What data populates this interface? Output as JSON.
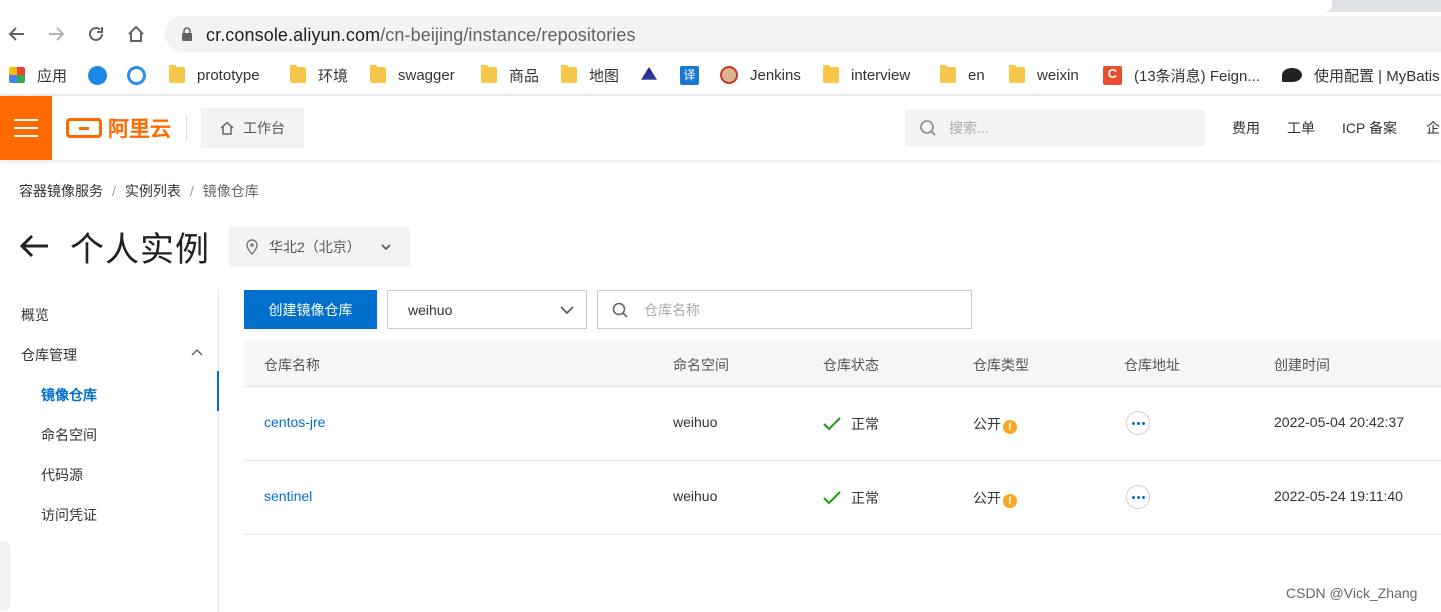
{
  "browser": {
    "url_host": "cr.console.aliyun.com",
    "url_path": "/cn-beijing/instance/repositories",
    "bookmarks": [
      {
        "label": "应用",
        "icon": "apps-grid-icon"
      },
      {
        "label": "",
        "icon": "blue-t-icon"
      },
      {
        "label": "",
        "icon": "blue-swirl-icon"
      },
      {
        "label": "prototype",
        "icon": "folder-icon"
      },
      {
        "label": "环境",
        "icon": "folder-icon"
      },
      {
        "label": "swagger",
        "icon": "folder-icon"
      },
      {
        "label": "商品",
        "icon": "folder-icon"
      },
      {
        "label": "地图",
        "icon": "folder-icon"
      },
      {
        "label": "",
        "icon": "ship-icon"
      },
      {
        "label": "",
        "icon": "translate-icon"
      },
      {
        "label": "Jenkins",
        "icon": "jenkins-icon"
      },
      {
        "label": "interview",
        "icon": "folder-icon"
      },
      {
        "label": "en",
        "icon": "folder-icon"
      },
      {
        "label": "weixin",
        "icon": "folder-icon"
      },
      {
        "label": "(13条消息) Feign...",
        "icon": "csdn-icon"
      },
      {
        "label": "使用配置 | MyBatis",
        "icon": "mybatis-bird-icon"
      }
    ]
  },
  "topbar": {
    "logo_text": "阿里云",
    "workbench_label": "工作台",
    "search_placeholder": "搜索...",
    "links": [
      "费用",
      "工单",
      "ICP 备案",
      "企"
    ]
  },
  "breadcrumb": [
    "容器镜像服务",
    "实例列表",
    "镜像仓库"
  ],
  "page": {
    "title": "个人实例",
    "region": "华北2（北京）"
  },
  "sidebar": {
    "items": [
      {
        "label": "概览"
      },
      {
        "label": "仓库管理"
      },
      {
        "label": "镜像仓库"
      },
      {
        "label": "命名空间"
      },
      {
        "label": "代码源"
      },
      {
        "label": "访问凭证"
      }
    ],
    "active": "镜像仓库"
  },
  "toolbar": {
    "create_label": "创建镜像仓库",
    "namespace_value": "weihuo",
    "search_placeholder": "仓库名称"
  },
  "table": {
    "columns": [
      "仓库名称",
      "命名空间",
      "仓库状态",
      "仓库类型",
      "仓库地址",
      "创建时间"
    ],
    "rows": [
      {
        "name": "centos-jre",
        "namespace": "weihuo",
        "status": "正常",
        "type": "公开",
        "created": "2022-05-04 20:42:37"
      },
      {
        "name": "sentinel",
        "namespace": "weihuo",
        "status": "正常",
        "type": "公开",
        "created": "2022-05-24 19:11:40"
      }
    ]
  },
  "watermark": "CSDN @Vick_Zhang",
  "colors": {
    "brand_orange": "#ff6a00",
    "primary_blue": "#0070cc",
    "success_green": "#2ba01f",
    "warning_amber": "#f5a623"
  }
}
